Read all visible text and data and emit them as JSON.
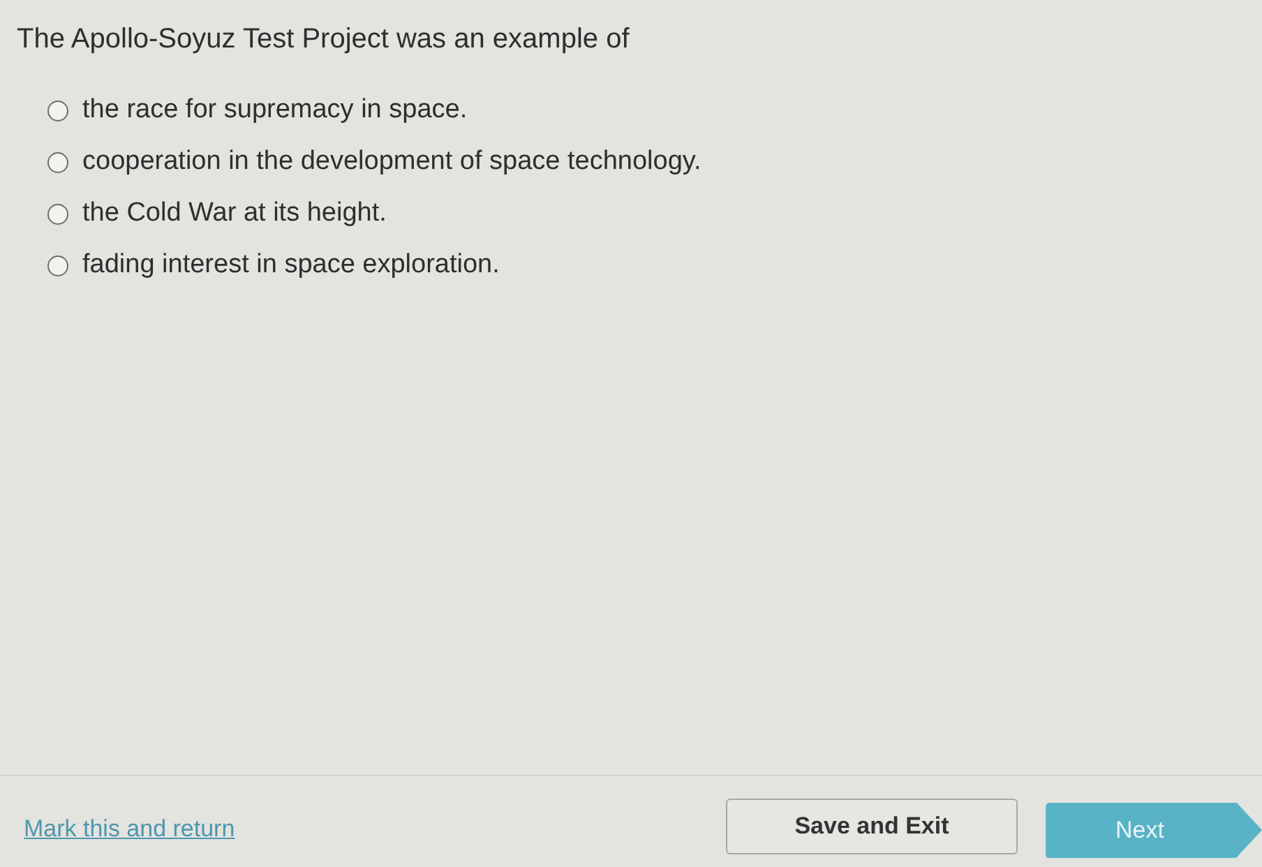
{
  "question": "The Apollo-Soyuz Test Project was an example of",
  "options": [
    {
      "label": "the race for supremacy in space.",
      "selected": false
    },
    {
      "label": "cooperation in the development of space technology.",
      "selected": false
    },
    {
      "label": "the Cold War at its height.",
      "selected": false
    },
    {
      "label": "fading interest in space exploration.",
      "selected": false
    }
  ],
  "footer": {
    "mark_link": "Mark this and return",
    "save_button": "Save and Exit",
    "next_button": "Next"
  }
}
